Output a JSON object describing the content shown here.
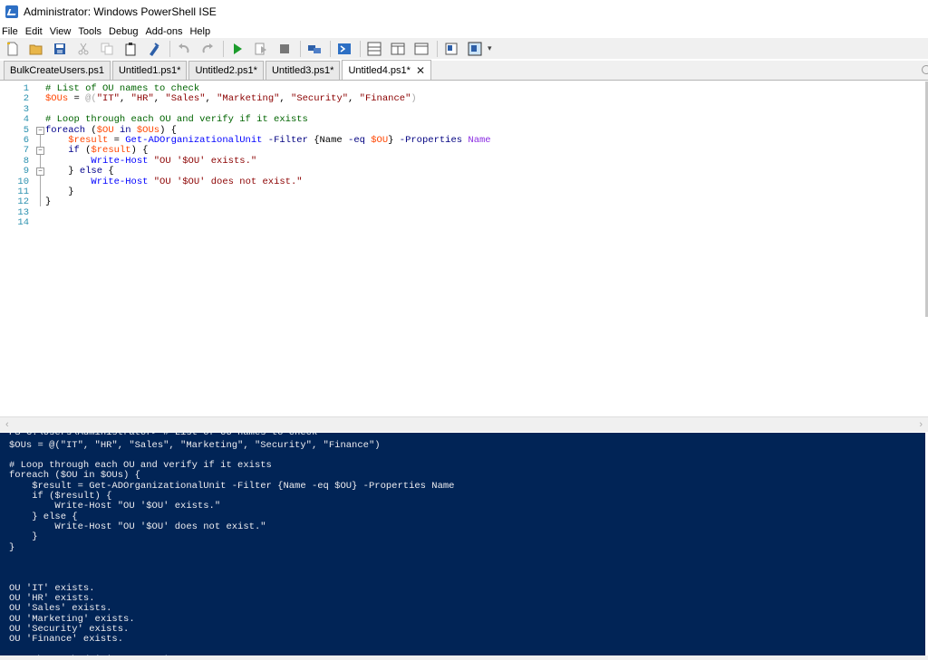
{
  "window": {
    "title": "Administrator: Windows PowerShell ISE"
  },
  "menu": [
    "File",
    "Edit",
    "View",
    "Tools",
    "Debug",
    "Add-ons",
    "Help"
  ],
  "toolbar": {
    "icons": [
      "new-file-icon",
      "open-folder-icon",
      "save-icon",
      "cut-icon",
      "copy-icon",
      "paste-icon",
      "clear-icon",
      "undo-icon",
      "redo-icon",
      "run-script-icon",
      "run-selection-icon",
      "stop-icon",
      "remote-session-icon",
      "powershell-console-icon",
      "script-pane-top-icon",
      "script-pane-right-icon",
      "script-pane-maximized-icon",
      "command-window-icon",
      "show-command-addon-icon"
    ]
  },
  "tabs": [
    {
      "label": "BulkCreateUsers.ps1",
      "active": false
    },
    {
      "label": "Untitled1.ps1*",
      "active": false
    },
    {
      "label": "Untitled2.ps1*",
      "active": false
    },
    {
      "label": "Untitled3.ps1*",
      "active": false
    },
    {
      "label": "Untitled4.ps1*",
      "active": true,
      "close": "✕"
    }
  ],
  "editor": {
    "line_numbers": [
      "1",
      "2",
      "3",
      "4",
      "5",
      "6",
      "7",
      "8",
      "9",
      "10",
      "11",
      "12",
      "13",
      "14"
    ],
    "fold_markers": {
      "5": "−",
      "7": "−",
      "9": "−"
    },
    "lines": [
      [
        [
          "cm",
          "# List of OU names to check"
        ]
      ],
      [
        [
          "var",
          "$OUs"
        ],
        [
          "df",
          " = "
        ],
        [
          "op",
          "@("
        ],
        [
          "str",
          "\"IT\""
        ],
        [
          "df",
          ", "
        ],
        [
          "str",
          "\"HR\""
        ],
        [
          "df",
          ", "
        ],
        [
          "str",
          "\"Sales\""
        ],
        [
          "df",
          ", "
        ],
        [
          "str",
          "\"Marketing\""
        ],
        [
          "df",
          ", "
        ],
        [
          "str",
          "\"Security\""
        ],
        [
          "df",
          ", "
        ],
        [
          "str",
          "\"Finance\""
        ],
        [
          "op",
          ")"
        ]
      ],
      [],
      [
        [
          "cm",
          "# Loop through each OU and verify if it exists"
        ]
      ],
      [
        [
          "kw",
          "foreach"
        ],
        [
          "df",
          " ("
        ],
        [
          "var",
          "$OU"
        ],
        [
          "df",
          " "
        ],
        [
          "kw",
          "in"
        ],
        [
          "df",
          " "
        ],
        [
          "var",
          "$OUs"
        ],
        [
          "df",
          ") {"
        ]
      ],
      [
        [
          "df",
          "    "
        ],
        [
          "var",
          "$result"
        ],
        [
          "df",
          " = "
        ],
        [
          "cmd",
          "Get-ADOrganizationalUnit"
        ],
        [
          "df",
          " "
        ],
        [
          "par",
          "-Filter"
        ],
        [
          "df",
          " {"
        ],
        [
          "df",
          "Name"
        ],
        [
          "df",
          " "
        ],
        [
          "par",
          "-eq"
        ],
        [
          "df",
          " "
        ],
        [
          "var",
          "$OU"
        ],
        [
          "df",
          "} "
        ],
        [
          "par",
          "-Properties"
        ],
        [
          "df",
          " "
        ],
        [
          "pn",
          "Name"
        ]
      ],
      [
        [
          "df",
          "    "
        ],
        [
          "kw",
          "if"
        ],
        [
          "df",
          " ("
        ],
        [
          "var",
          "$result"
        ],
        [
          "df",
          ") {"
        ]
      ],
      [
        [
          "df",
          "        "
        ],
        [
          "cmd",
          "Write-Host"
        ],
        [
          "df",
          " "
        ],
        [
          "str",
          "\"OU '$OU' exists.\""
        ]
      ],
      [
        [
          "df",
          "    } "
        ],
        [
          "kw",
          "else"
        ],
        [
          "df",
          " {"
        ]
      ],
      [
        [
          "df",
          "        "
        ],
        [
          "cmd",
          "Write-Host"
        ],
        [
          "df",
          " "
        ],
        [
          "str",
          "\"OU '$OU' does not exist.\""
        ]
      ],
      [
        [
          "df",
          "    }"
        ]
      ],
      [
        [
          "df",
          "}"
        ]
      ],
      [],
      []
    ]
  },
  "console": {
    "partial_top": "PS C:\\Users\\Administrator> # List of OU names to check",
    "lines": [
      "$OUs = @(\"IT\", \"HR\", \"Sales\", \"Marketing\", \"Security\", \"Finance\")",
      "",
      "# Loop through each OU and verify if it exists",
      "foreach ($OU in $OUs) {",
      "    $result = Get-ADOrganizationalUnit -Filter {Name -eq $OU} -Properties Name",
      "    if ($result) {",
      "        Write-Host \"OU '$OU' exists.\"",
      "    } else {",
      "        Write-Host \"OU '$OU' does not exist.\"",
      "    }",
      "}",
      "",
      "",
      "",
      "OU 'IT' exists.",
      "OU 'HR' exists.",
      "OU 'Sales' exists.",
      "OU 'Marketing' exists.",
      "OU 'Security' exists.",
      "OU 'Finance' exists.",
      "",
      "PS C:\\Users\\Administrator> |"
    ]
  },
  "colors": {
    "console_bg": "#012456",
    "comment": "#006400",
    "variable": "#ff4500",
    "string": "#8b0000",
    "keyword": "#00008b",
    "command": "#0000ff",
    "parameter": "#000080",
    "line_number": "#2b91af"
  }
}
